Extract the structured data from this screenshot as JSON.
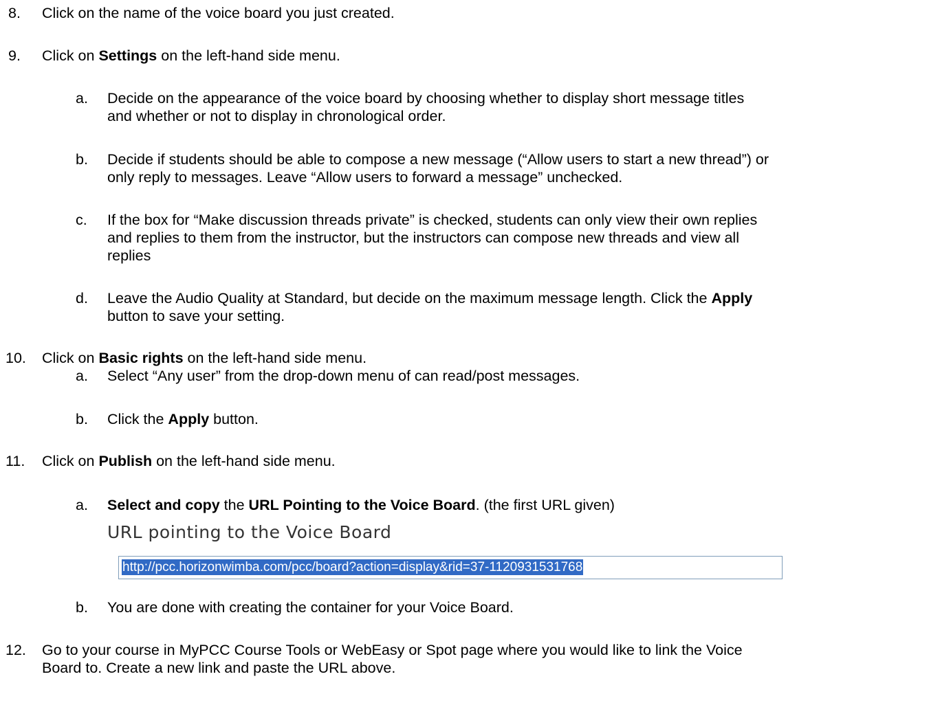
{
  "steps": {
    "s8": {
      "num": "8.",
      "text": "Click on the name of the voice board you just created."
    },
    "s9": {
      "num": "9.",
      "pre": "Click on ",
      "bold": "Settings",
      "post": " on the left-hand side menu.",
      "a": {
        "label": "a.",
        "line1": "Decide on the appearance of the voice board by choosing whether to display short message titles",
        "line2": "and whether or not to display in chronological order."
      },
      "b": {
        "label": "b.",
        "line1": "Decide if students should be able to compose a new message (“Allow users to start a new thread”) or",
        "line2": "only reply to messages.   Leave “Allow users to forward a message” unchecked."
      },
      "c": {
        "label": "c.",
        "line1": "If the box for “Make discussion threads private” is checked, students can only view their own replies",
        "line2": "and replies to them from the instructor, but the instructors can compose new threads and view all",
        "line3": "replies"
      },
      "d": {
        "label": "d.",
        "line1_pre": "Leave the Audio Quality at Standard, but decide on the maximum message length.  Click the ",
        "line1_bold": "Apply",
        "line2": "button to save your setting."
      }
    },
    "s10": {
      "num": "10.",
      "pre": "Click on ",
      "bold": "Basic rights",
      "post": " on the left-hand side menu.",
      "a": {
        "label": "a.",
        "text": "Select “Any user” from the drop-down menu of can read/post messages."
      },
      "b": {
        "label": "b.",
        "pre": "Click the ",
        "bold": "Apply",
        "post": " button."
      }
    },
    "s11": {
      "num": "11.",
      "pre": "Click on ",
      "bold": "Publish",
      "post": " on the left-hand side menu.",
      "a": {
        "label": "a.",
        "bold1": "Select and copy",
        "mid": " the ",
        "bold2": "URL Pointing to the Voice Board",
        "post": ".  (the first URL given)"
      },
      "url_heading": "URL pointing to the Voice Board",
      "url_value": "http://pcc.horizonwimba.com/pcc/board?action=display&rid=37-1120931531768",
      "b": {
        "label": "b.",
        "text": "You are done with creating the container for your Voice Board."
      }
    },
    "s12": {
      "num": "12.",
      "line1": "Go to your course in MyPCC Course Tools or WebEasy or Spot page where you would like to link the Voice",
      "line2": "Board to. Create a new link and paste the URL above."
    }
  }
}
